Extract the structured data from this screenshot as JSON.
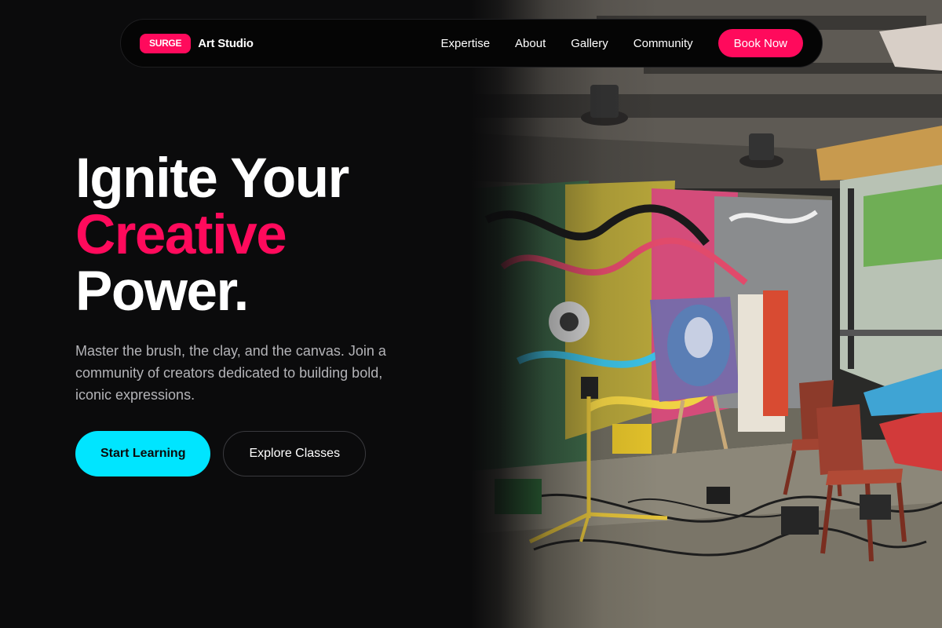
{
  "brand": {
    "badge": "SURGE",
    "name": "Art Studio"
  },
  "nav": {
    "links": [
      "Expertise",
      "About",
      "Gallery",
      "Community"
    ],
    "cta": "Book Now"
  },
  "hero": {
    "headline_line1": "Ignite Your",
    "headline_line2": "Creative",
    "headline_line3": "Power.",
    "subtext": "Master the brush, the clay, and the canvas. Join a community of creators dedicated to building bold, iconic expressions.",
    "primary_cta": "Start Learning",
    "secondary_cta": "Explore Classes"
  },
  "colors": {
    "accent_pink": "#ff0a5c",
    "accent_cyan": "#00e5ff",
    "background": "#0b0b0c"
  }
}
